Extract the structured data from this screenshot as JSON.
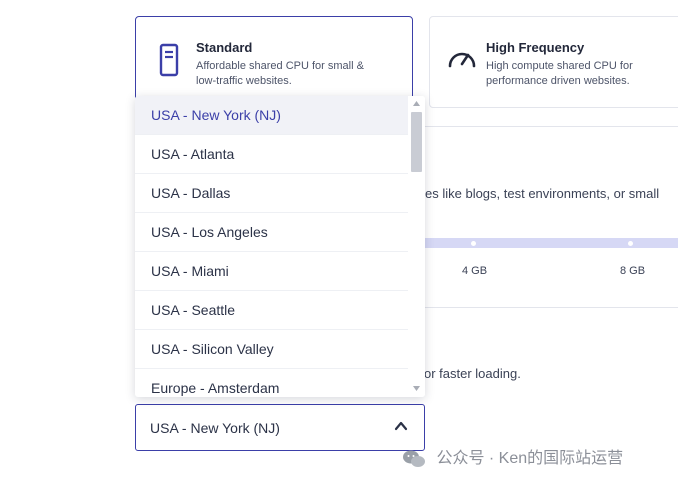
{
  "plans": [
    {
      "title": "Standard",
      "desc_line1": "Affordable shared CPU for small &",
      "desc_line2": "low-traffic websites.",
      "icon": "server-icon",
      "selected": true
    },
    {
      "title": "High Frequency",
      "desc_line1": "High compute shared CPU for",
      "desc_line2": "performance driven websites.",
      "icon": "speedometer-icon",
      "selected": false
    }
  ],
  "plan_section": {
    "description": "sites like blogs, test environments, or small",
    "slider_labels": [
      "4 GB",
      "8 GB"
    ]
  },
  "location_section": {
    "description": "or faster loading."
  },
  "location_select": {
    "value": "USA - New York (NJ)",
    "options": [
      "USA - New York (NJ)",
      "USA - Atlanta",
      "USA - Dallas",
      "USA - Los Angeles",
      "USA - Miami",
      "USA - Seattle",
      "USA - Silicon Valley",
      "Europe - Amsterdam"
    ]
  },
  "watermark": "公众号 · Ken的国际站运营",
  "colors": {
    "accent": "#3b3fa8",
    "track": "#d6d8f5",
    "active_bg": "#f1f2f7"
  }
}
